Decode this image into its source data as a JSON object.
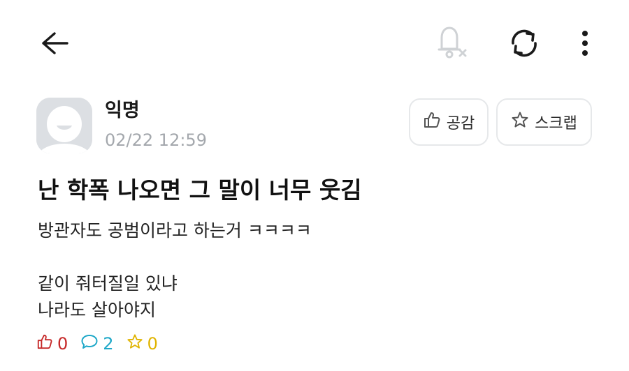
{
  "author": {
    "name": "익명",
    "time": "02/22 12:59"
  },
  "actions": {
    "like_label": "공감",
    "scrap_label": "스크랩"
  },
  "post": {
    "title": "난 학폭 나오면 그 말이 너무 웃김",
    "lines": [
      "방관자도 공범이라고 하는거 ㅋㅋㅋㅋ",
      "",
      "같이 줘터질일 있냐",
      "나라도 살아야지"
    ]
  },
  "stats": {
    "likes": "0",
    "comments": "2",
    "scraps": "0"
  },
  "colors": {
    "like": "#c62828",
    "comment": "#1fa8c8",
    "scrap": "#e0b400",
    "muted": "#a4a8ad"
  },
  "icons": [
    "back-arrow-icon",
    "bell-off-icon",
    "refresh-icon",
    "more-vertical-icon",
    "thumbs-up-icon",
    "star-icon",
    "comment-icon"
  ]
}
